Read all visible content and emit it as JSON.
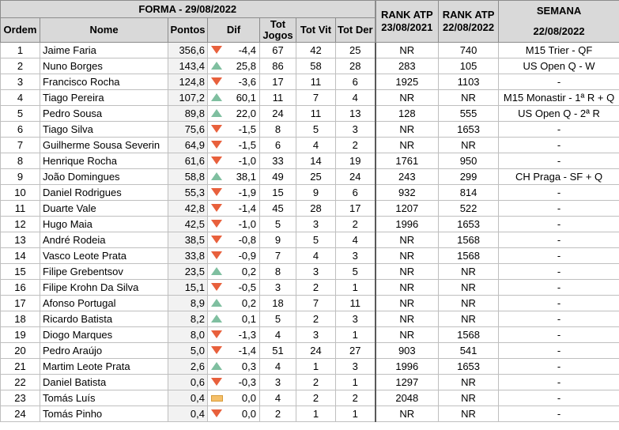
{
  "header": {
    "forma_title": "FORMA - 29/08/2022",
    "col_ordem": "Ordem",
    "col_nome": "Nome",
    "col_pontos": "Pontos",
    "col_dif": "Dif",
    "col_tot_jogos_1": "Tot",
    "col_tot_jogos_2": "Jogos",
    "col_tot_vit": "Tot Vit",
    "col_tot_der": "Tot Der",
    "rank1_1": "RANK ATP",
    "rank1_2": "23/08/2021",
    "rank2_1": "RANK ATP",
    "rank2_2": "22/08/2022",
    "semana_1": "SEMANA",
    "semana_2": "22/08/2022"
  },
  "trend_colors": {
    "up": "#7fbfa0",
    "down": "#e8603c",
    "flat": "#f5c06a"
  },
  "rows": [
    {
      "ordem": "1",
      "nome": "Jaime Faria",
      "pontos": "356,6",
      "trend": "down",
      "dif": "-4,4",
      "jogos": "67",
      "vit": "42",
      "der": "25",
      "rank21": "NR",
      "rank22": "740",
      "semana": "M15 Trier - QF"
    },
    {
      "ordem": "2",
      "nome": "Nuno Borges",
      "pontos": "143,4",
      "trend": "up",
      "dif": "25,8",
      "jogos": "86",
      "vit": "58",
      "der": "28",
      "rank21": "283",
      "rank22": "105",
      "semana": "US Open Q - W"
    },
    {
      "ordem": "3",
      "nome": "Francisco Rocha",
      "pontos": "124,8",
      "trend": "down",
      "dif": "-3,6",
      "jogos": "17",
      "vit": "11",
      "der": "6",
      "rank21": "1925",
      "rank22": "1103",
      "semana": "-"
    },
    {
      "ordem": "4",
      "nome": "Tiago Pereira",
      "pontos": "107,2",
      "trend": "up",
      "dif": "60,1",
      "jogos": "11",
      "vit": "7",
      "der": "4",
      "rank21": "NR",
      "rank22": "NR",
      "semana": "M15 Monastir - 1ª R + Q"
    },
    {
      "ordem": "5",
      "nome": "Pedro Sousa",
      "pontos": "89,8",
      "trend": "up",
      "dif": "22,0",
      "jogos": "24",
      "vit": "11",
      "der": "13",
      "rank21": "128",
      "rank22": "555",
      "semana": "US Open Q - 2ª R"
    },
    {
      "ordem": "6",
      "nome": "Tiago Silva",
      "pontos": "75,6",
      "trend": "down",
      "dif": "-1,5",
      "jogos": "8",
      "vit": "5",
      "der": "3",
      "rank21": "NR",
      "rank22": "1653",
      "semana": "-"
    },
    {
      "ordem": "7",
      "nome": "Guilherme Sousa Severin",
      "pontos": "64,9",
      "trend": "down",
      "dif": "-1,5",
      "jogos": "6",
      "vit": "4",
      "der": "2",
      "rank21": "NR",
      "rank22": "NR",
      "semana": "-"
    },
    {
      "ordem": "8",
      "nome": "Henrique Rocha",
      "pontos": "61,6",
      "trend": "down",
      "dif": "-1,0",
      "jogos": "33",
      "vit": "14",
      "der": "19",
      "rank21": "1761",
      "rank22": "950",
      "semana": "-"
    },
    {
      "ordem": "9",
      "nome": "João Domingues",
      "pontos": "58,8",
      "trend": "up",
      "dif": "38,1",
      "jogos": "49",
      "vit": "25",
      "der": "24",
      "rank21": "243",
      "rank22": "299",
      "semana": "CH Praga - SF + Q"
    },
    {
      "ordem": "10",
      "nome": "Daniel Rodrigues",
      "pontos": "55,3",
      "trend": "down",
      "dif": "-1,9",
      "jogos": "15",
      "vit": "9",
      "der": "6",
      "rank21": "932",
      "rank22": "814",
      "semana": "-"
    },
    {
      "ordem": "11",
      "nome": "Duarte Vale",
      "pontos": "42,8",
      "trend": "down",
      "dif": "-1,4",
      "jogos": "45",
      "vit": "28",
      "der": "17",
      "rank21": "1207",
      "rank22": "522",
      "semana": "-"
    },
    {
      "ordem": "12",
      "nome": "Hugo Maia",
      "pontos": "42,5",
      "trend": "down",
      "dif": "-1,0",
      "jogos": "5",
      "vit": "3",
      "der": "2",
      "rank21": "1996",
      "rank22": "1653",
      "semana": "-"
    },
    {
      "ordem": "13",
      "nome": "André Rodeia",
      "pontos": "38,5",
      "trend": "down",
      "dif": "-0,8",
      "jogos": "9",
      "vit": "5",
      "der": "4",
      "rank21": "NR",
      "rank22": "1568",
      "semana": "-"
    },
    {
      "ordem": "14",
      "nome": "Vasco Leote Prata",
      "pontos": "33,8",
      "trend": "down",
      "dif": "-0,9",
      "jogos": "7",
      "vit": "4",
      "der": "3",
      "rank21": "NR",
      "rank22": "1568",
      "semana": "-"
    },
    {
      "ordem": "15",
      "nome": "Filipe Grebentsov",
      "pontos": "23,5",
      "trend": "up",
      "dif": "0,2",
      "jogos": "8",
      "vit": "3",
      "der": "5",
      "rank21": "NR",
      "rank22": "NR",
      "semana": "-"
    },
    {
      "ordem": "16",
      "nome": "Filipe Krohn Da Silva",
      "pontos": "15,1",
      "trend": "down",
      "dif": "-0,5",
      "jogos": "3",
      "vit": "2",
      "der": "1",
      "rank21": "NR",
      "rank22": "NR",
      "semana": "-"
    },
    {
      "ordem": "17",
      "nome": "Afonso Portugal",
      "pontos": "8,9",
      "trend": "up",
      "dif": "0,2",
      "jogos": "18",
      "vit": "7",
      "der": "11",
      "rank21": "NR",
      "rank22": "NR",
      "semana": "-"
    },
    {
      "ordem": "18",
      "nome": "Ricardo Batista",
      "pontos": "8,2",
      "trend": "up",
      "dif": "0,1",
      "jogos": "5",
      "vit": "2",
      "der": "3",
      "rank21": "NR",
      "rank22": "NR",
      "semana": "-"
    },
    {
      "ordem": "19",
      "nome": "Diogo Marques",
      "pontos": "8,0",
      "trend": "down",
      "dif": "-1,3",
      "jogos": "4",
      "vit": "3",
      "der": "1",
      "rank21": "NR",
      "rank22": "1568",
      "semana": "-"
    },
    {
      "ordem": "20",
      "nome": "Pedro Araújo",
      "pontos": "5,0",
      "trend": "down",
      "dif": "-1,4",
      "jogos": "51",
      "vit": "24",
      "der": "27",
      "rank21": "903",
      "rank22": "541",
      "semana": "-"
    },
    {
      "ordem": "21",
      "nome": "Martim Leote Prata",
      "pontos": "2,6",
      "trend": "up",
      "dif": "0,3",
      "jogos": "4",
      "vit": "1",
      "der": "3",
      "rank21": "1996",
      "rank22": "1653",
      "semana": "-"
    },
    {
      "ordem": "22",
      "nome": "Daniel Batista",
      "pontos": "0,6",
      "trend": "down",
      "dif": "-0,3",
      "jogos": "3",
      "vit": "2",
      "der": "1",
      "rank21": "1297",
      "rank22": "NR",
      "semana": "-"
    },
    {
      "ordem": "23",
      "nome": "Tomás Luís",
      "pontos": "0,4",
      "trend": "flat",
      "dif": "0,0",
      "jogos": "4",
      "vit": "2",
      "der": "2",
      "rank21": "2048",
      "rank22": "NR",
      "semana": "-"
    },
    {
      "ordem": "24",
      "nome": "Tomás Pinho",
      "pontos": "0,4",
      "trend": "down",
      "dif": "0,0",
      "jogos": "2",
      "vit": "1",
      "der": "1",
      "rank21": "NR",
      "rank22": "NR",
      "semana": "-"
    }
  ]
}
